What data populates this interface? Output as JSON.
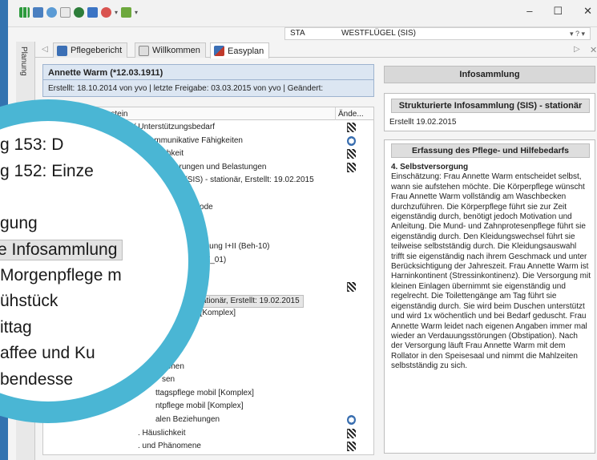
{
  "ribbon": {
    "quick_access_icons": [
      "green-bars-icon",
      "gear-icon",
      "search-icon",
      "globe-icon",
      "refresh-icon",
      "add-icon",
      "users-icon",
      "settings-icon"
    ],
    "dropdown_glyph": "▾"
  },
  "window": {
    "minimize": "–",
    "maximize": "☐",
    "close": "✕"
  },
  "station": {
    "code": "STA",
    "ward": "WESTFLÜGEL (SIS)"
  },
  "side_tab": {
    "label": "Planung"
  },
  "tabs": [
    {
      "label": "Pflegebericht",
      "active": false
    },
    {
      "label": "Willkommen",
      "active": false
    },
    {
      "label": "Easyplan",
      "active": true
    }
  ],
  "patient": {
    "name": "Annette Warm (*12.03.1911)",
    "info": "Erstellt: 18.10.2014 von yvo | letzte Freigabe: 03.03.2015 von yvo | Geändert:"
  },
  "table": {
    "columns": [
      "Domäne/Baustein",
      "Ände..."
    ],
    "rows": [
      {
        "text": "esituation/ Unterstützungsbedarf",
        "indent": 70,
        "icon": "flag"
      },
      {
        "text": "e und kommunikative Fähigkeiten",
        "indent": 100,
        "icon": "clock"
      },
      {
        "text": "nd Beweglichkeit",
        "indent": 100,
        "icon": "flag"
      },
      {
        "text": "gene Anforderungen und Belastungen",
        "indent": 110,
        "icon": "flag"
      },
      {
        "text": "nsammlung (SIS) - stationär, Erstellt: 19.02.2015",
        "indent": 122,
        "icon": ""
      },
      {
        "text": "",
        "indent": 0,
        "icon": ""
      },
      {
        "text": "ssive Episode",
        "indent": 150,
        "icon": ""
      },
      {
        "text": "",
        "indent": 0,
        "icon": ""
      },
      {
        "text": "gees SN",
        "indent": 156,
        "icon": ""
      },
      {
        "text": "itusbehandlung I+II (Beh-10)",
        "indent": 156,
        "icon": ""
      },
      {
        "text": "herapie (ET_01)",
        "indent": 156,
        "icon": ""
      },
      {
        "text": "",
        "indent": 0,
        "icon": ""
      },
      {
        "text": "",
        "indent": 0,
        "icon": "flag"
      },
      {
        "text": "ung (SIS) - stationär, Erstellt: 19.02.2015",
        "indent": 134,
        "icon": "",
        "selected": true
      },
      {
        "text": "ge mobil [Komplex]",
        "indent": 155,
        "icon": ""
      },
      {
        "text": "",
        "indent": 0,
        "icon": ""
      },
      {
        "text": "",
        "indent": 0,
        "icon": ""
      },
      {
        "text": "",
        "indent": 0,
        "icon": ""
      },
      {
        "text": "Kuchen",
        "indent": 142,
        "icon": ""
      },
      {
        "text": "sen",
        "indent": 148,
        "icon": ""
      },
      {
        "text": "ttagspflege mobil [Komplex]",
        "indent": 140,
        "icon": ""
      },
      {
        "text": "ntpflege mobil [Komplex]",
        "indent": 140,
        "icon": ""
      },
      {
        "text": "alen Beziehungen",
        "indent": 140,
        "icon": "clock"
      },
      {
        "text": ". Häuslichkeit",
        "indent": 118,
        "icon": "flag"
      },
      {
        "text": ". und Phänomene",
        "indent": 118,
        "icon": "flag"
      }
    ]
  },
  "magnifier": {
    "rows": [
      {
        "text": "g 153: D",
        "selected": false
      },
      {
        "text": "g 152: Einze",
        "selected": false
      },
      {
        "text": "",
        "selected": false
      },
      {
        "text": "gung",
        "selected": false
      },
      {
        "text": "e Infosammlung",
        "selected": true
      },
      {
        "text": "Morgenpflege m",
        "selected": false
      },
      {
        "text": "ühstück",
        "selected": false
      },
      {
        "text": "ittag",
        "selected": false
      },
      {
        "text": "affee und Ku",
        "selected": false
      },
      {
        "text": "bendesse",
        "selected": false
      }
    ]
  },
  "right_panel": {
    "header": "Infosammlung",
    "sis": {
      "title": "Strukturierte Infosammlung (SIS) - stationär",
      "created": "Erstellt   19.02.2015"
    },
    "erfassung": {
      "title": "Erfassung des Pflege- und Hilfebedarfs",
      "section_title": "4. Selbstversorgung",
      "text": "Einschätzung: Frau Annette Warm entscheidet selbst, wann sie aufstehen möchte. Die Körperpflege wünscht Frau Annette Warm vollständig am Waschbecken durchzuführen. Die Körperpflege führt sie zur Zeit eigenständig durch, benötigt jedoch Motivation und Anleitung. Die Mund- und Zahnprotesenpflege führt sie eigenständig durch. Den Kleidungswechsel führt sie teilweise selbstständig durch. Die Kleidungsauswahl trifft sie eigenständig nach ihrem Geschmack und unter Berücksichtigung der Jahreszeit. Frau Annette Warm ist Harninkontinent (Stressinkontinenz). Die Versorgung mit kleinen Einlagen übernimmt sie eigenständig und regelrecht. Die Toilettengänge am Tag führt sie eigenständig durch. Sie wird beim Duschen unterstützt und wird 1x wöchentlich und bei Bedarf geduscht. Frau Annette Warm leidet nach eigenen Angaben immer mal wieder an Verdauungsstörungen (Obstipation). Nach der Versorgung läuft Frau Annette Warm mit dem Rollator in den Speisesaal und nimmt die Mahlzeiten selbstständig zu sich."
    }
  },
  "colors": {
    "frame_blue": "#3373b0",
    "lens_ring": "#4ab6d4",
    "patient_bg": "#dce6f2"
  }
}
